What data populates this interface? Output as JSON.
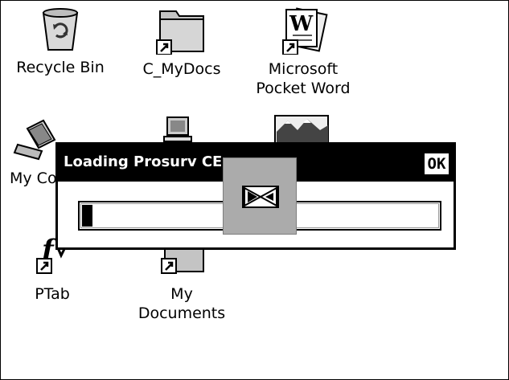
{
  "desktop": {
    "icons": [
      {
        "label": "Recycle Bin",
        "icon": "recycle-bin-icon"
      },
      {
        "label": "C_MyDocs",
        "icon": "folder-icon"
      },
      {
        "label": "Microsoft\nPocket Word",
        "icon": "pocket-word-icon"
      },
      {
        "label": "My Co",
        "icon": "my-computer-icon"
      },
      {
        "label": "PTab",
        "icon": "ptab-icon"
      },
      {
        "label": "My Documents",
        "icon": "my-documents-icon"
      }
    ]
  },
  "dialog": {
    "title": "Loading Prosurv CE",
    "ok_label": "OK",
    "progress": 0.03
  },
  "wait_cursor": "hourglass-icon"
}
